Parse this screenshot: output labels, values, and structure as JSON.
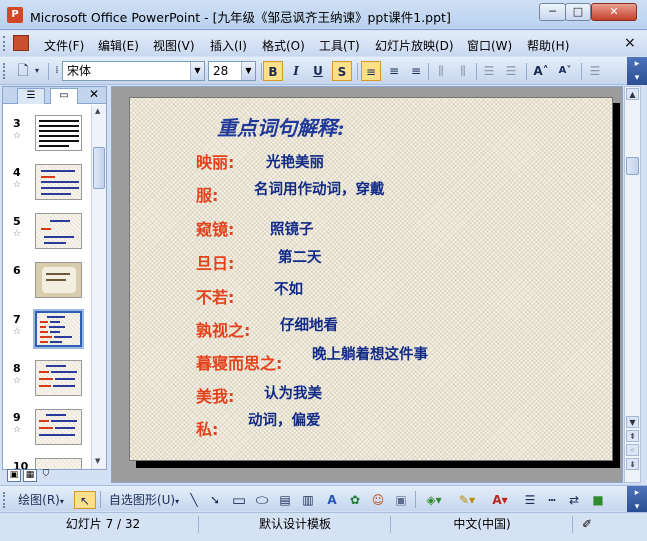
{
  "window": {
    "title": "Microsoft Office PowerPoint - [九年级《邹忌讽齐王纳谏》ppt课件1.ppt]",
    "minimize": "─",
    "maximize": "□",
    "close": "✕"
  },
  "menu": {
    "items": [
      "文件(F)",
      "编辑(E)",
      "视图(V)",
      "插入(I)",
      "格式(O)",
      "工具(T)",
      "幻灯片放映(D)",
      "窗口(W)",
      "帮助(H)"
    ],
    "close_doc": "×"
  },
  "toolbar": {
    "font_name": "宋体",
    "font_size": "28",
    "bold": "B",
    "italic": "I",
    "underline": "U",
    "shadow": "S"
  },
  "left_pane": {
    "thumbnails": [
      {
        "number": "3"
      },
      {
        "number": "4"
      },
      {
        "number": "5"
      },
      {
        "number": "6"
      },
      {
        "number": "7"
      },
      {
        "number": "8"
      },
      {
        "number": "9"
      },
      {
        "number": "10"
      }
    ],
    "selected": "7"
  },
  "slide": {
    "title": "重点词句解释:",
    "entries": [
      {
        "term": "映丽:",
        "definition": "光艳美丽"
      },
      {
        "term": "服:",
        "definition": "名词用作动词，穿戴"
      },
      {
        "term": "窥镜:",
        "definition": "照镜子"
      },
      {
        "term": "旦日:",
        "definition": "第二天"
      },
      {
        "term": "不若:",
        "definition": "不如"
      },
      {
        "term": "孰视之:",
        "definition": "仔细地看"
      },
      {
        "term": "暮寝而思之:",
        "definition": "晚上躺着想这件事"
      },
      {
        "term": "美我:",
        "definition": "认为我美"
      },
      {
        "term": "私:",
        "definition": "动词，偏爱"
      }
    ]
  },
  "draw_toolbar": {
    "draw_menu": "绘图(R)",
    "autoshapes_menu": "自选图形(U)"
  },
  "status": {
    "slide_position": "幻灯片 7 / 32",
    "design_template": "默认设计模板",
    "language": "中文(中国)"
  },
  "colors": {
    "term": "#e4421c",
    "definition": "#122a88",
    "title": "#213a9a"
  }
}
